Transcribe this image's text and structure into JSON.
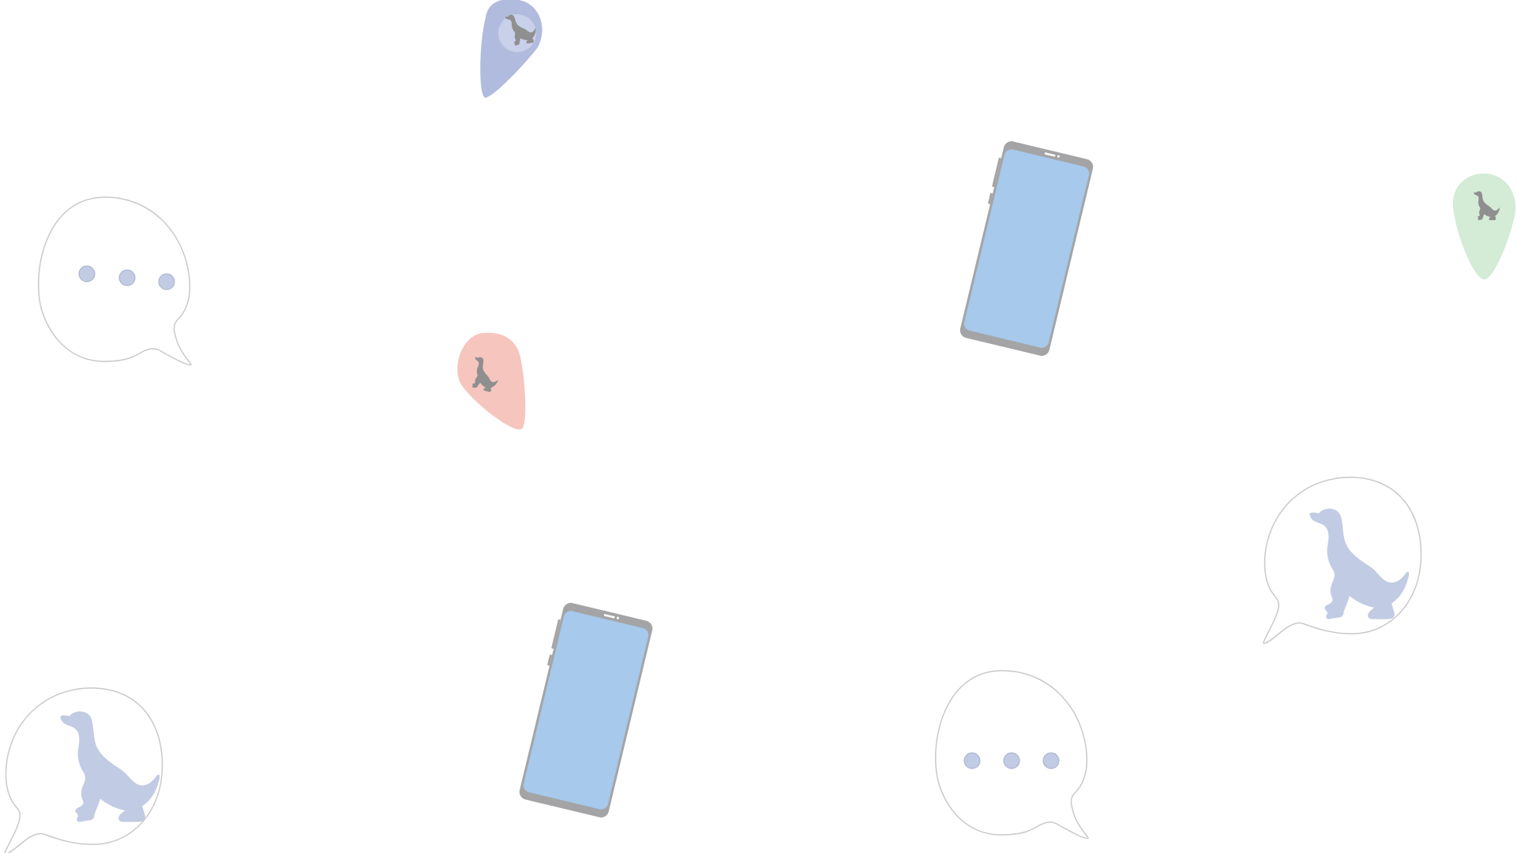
{
  "colors": {
    "background": "#ffffff",
    "bubble_outline": "#c9c9c9",
    "dot": "#c1cbe3",
    "dot_outline": "#a6b1cc",
    "dog_bubble": "#c1cbe3",
    "phone_body": "#a4a4a6",
    "phone_screen": "#a6c9ec",
    "pin_blue": "#b1bbdd",
    "pin_blue_inner": "#c8d0ea",
    "pin_pink": "#f6c5be",
    "pin_green": "#d4ebd5",
    "pin_dog": "#8f8f8f"
  },
  "elements": {
    "chat_bubbles": [
      "typing-indicator",
      "dog-icon",
      "dog-icon",
      "typing-indicator"
    ],
    "phones": [
      "smartphone",
      "smartphone"
    ],
    "location_pins": [
      "blue",
      "pink",
      "green"
    ]
  }
}
